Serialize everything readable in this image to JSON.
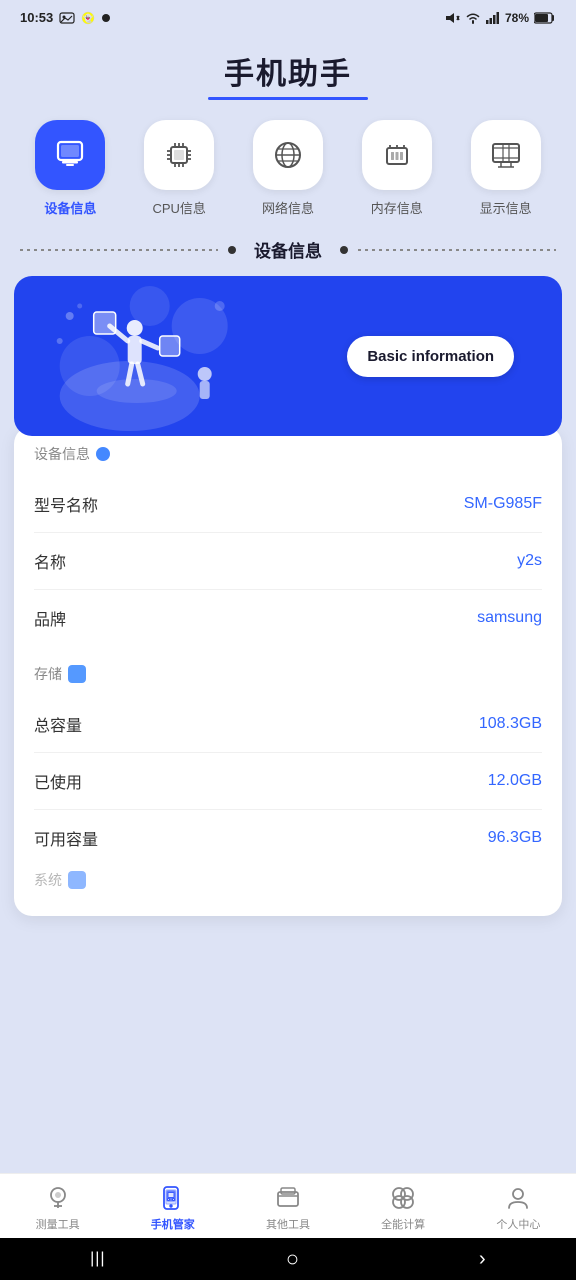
{
  "statusBar": {
    "time": "10:53",
    "battery": "78%"
  },
  "appTitle": "手机助手",
  "navItems": [
    {
      "id": "device",
      "label": "设备信息",
      "active": true
    },
    {
      "id": "cpu",
      "label": "CPU信息",
      "active": false
    },
    {
      "id": "network",
      "label": "网络信息",
      "active": false
    },
    {
      "id": "memory",
      "label": "内存信息",
      "active": false
    },
    {
      "id": "display",
      "label": "显示信息",
      "active": false
    }
  ],
  "sectionTitle": "设备信息",
  "banner": {
    "badgeText": "Basic information"
  },
  "deviceInfo": {
    "sectionLabel": "设备信息",
    "rows": [
      {
        "label": "型号名称",
        "value": "SM-G985F"
      },
      {
        "label": "名称",
        "value": "y2s"
      },
      {
        "label": "品牌",
        "value": "samsung"
      }
    ]
  },
  "storageInfo": {
    "sectionLabel": "存储",
    "rows": [
      {
        "label": "总容量",
        "value": "108.3GB"
      },
      {
        "label": "已使用",
        "value": "12.0GB"
      },
      {
        "label": "可用容量",
        "value": "96.3GB"
      }
    ]
  },
  "partialSection": {
    "label": "系统"
  },
  "bottomNav": [
    {
      "id": "measure",
      "label": "测量工具",
      "active": false
    },
    {
      "id": "phone",
      "label": "手机管家",
      "active": true
    },
    {
      "id": "tools",
      "label": "其他工具",
      "active": false
    },
    {
      "id": "calc",
      "label": "全能计算",
      "active": false
    },
    {
      "id": "profile",
      "label": "个人中心",
      "active": false
    }
  ],
  "sysNav": {
    "buttons": [
      "|||",
      "○",
      "‹"
    ]
  }
}
